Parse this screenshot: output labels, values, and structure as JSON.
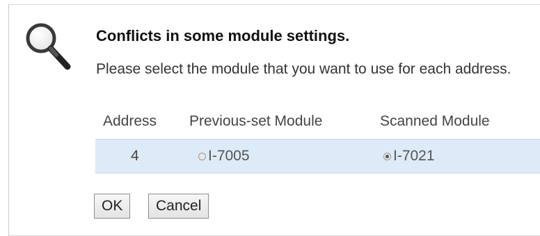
{
  "dialog": {
    "title": "Conflicts in some module settings.",
    "message": "Please select the module that you want to use for each address."
  },
  "table": {
    "headers": [
      "Address",
      "Previous-set Module",
      "Scanned Module"
    ],
    "rows": [
      {
        "address": "4",
        "previous_module": "I-7005",
        "previous_selected": false,
        "scanned_module": "I-7021",
        "scanned_selected": true
      }
    ]
  },
  "buttons": {
    "ok_label": "OK",
    "cancel_label": "Cancel"
  },
  "icons": {
    "dialog_icon": "magnifier-icon"
  },
  "colors": {
    "row_highlight": "#ddeaf7"
  }
}
